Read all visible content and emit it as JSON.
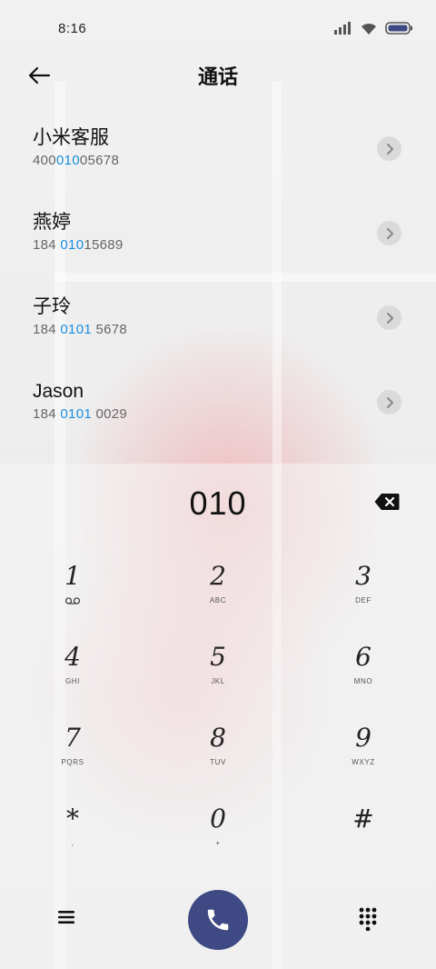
{
  "status_bar": {
    "time": "8:16",
    "icons": [
      "signal-icon",
      "wifi-icon",
      "battery-icon"
    ]
  },
  "header": {
    "title": "通话",
    "back_icon": "arrow-left-icon"
  },
  "contacts": [
    {
      "name": "小米客服",
      "number_pre": "400",
      "number_match": "010",
      "number_post": "05678"
    },
    {
      "name": "燕婷",
      "number_pre": "184 ",
      "number_match": "010",
      "number_post": "15689"
    },
    {
      "name": "子玲",
      "number_pre": "184 ",
      "number_match": "0101",
      "number_post": " 5678"
    },
    {
      "name": "Jason",
      "number_pre": "184 ",
      "number_match": "0101",
      "number_post": " 0029"
    }
  ],
  "dialer": {
    "number": "010",
    "keys": [
      {
        "digit": "1",
        "letters": ""
      },
      {
        "digit": "2",
        "letters": "ABC"
      },
      {
        "digit": "3",
        "letters": "DEF"
      },
      {
        "digit": "4",
        "letters": "GHI"
      },
      {
        "digit": "5",
        "letters": "JKL"
      },
      {
        "digit": "6",
        "letters": "MNO"
      },
      {
        "digit": "7",
        "letters": "PQRS"
      },
      {
        "digit": "8",
        "letters": "TUV"
      },
      {
        "digit": "9",
        "letters": "WXYZ"
      },
      {
        "digit": "*",
        "letters": ","
      },
      {
        "digit": "0",
        "letters": "+"
      },
      {
        "digit": "#",
        "letters": ""
      }
    ]
  },
  "colors": {
    "accent": "#1a8fe0",
    "call_button": "#3f4a85"
  }
}
